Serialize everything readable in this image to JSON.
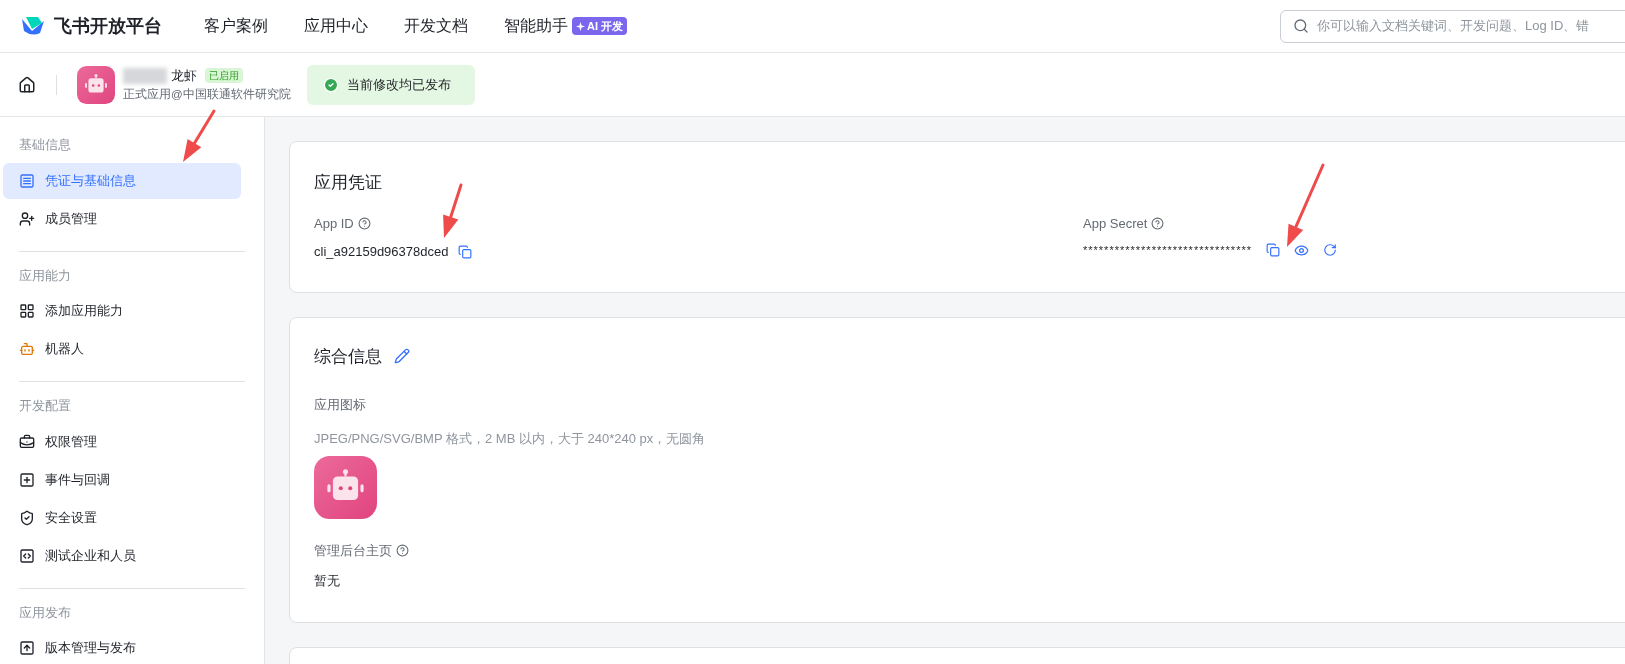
{
  "header": {
    "brand": "飞书开放平台",
    "nav": [
      {
        "label": "客户案例"
      },
      {
        "label": "应用中心"
      },
      {
        "label": "开发文档"
      },
      {
        "label": "智能助手",
        "badge": "AI 开发"
      }
    ],
    "search": {
      "placeholder": "你可以输入文档关键词、开发问题、Log ID、错"
    }
  },
  "app_bar": {
    "name": "龙虾",
    "status": "已启用",
    "org": "正式应用@中国联通软件研究院",
    "notice": "当前修改均已发布"
  },
  "sidebar": {
    "groups": [
      {
        "title": "基础信息",
        "items": [
          {
            "label": "凭证与基础信息",
            "kind": "card",
            "selected": true
          },
          {
            "label": "成员管理",
            "kind": "user",
            "selected": false
          }
        ]
      },
      {
        "title": "应用能力",
        "items": [
          {
            "label": "添加应用能力",
            "kind": "grid",
            "selected": false
          },
          {
            "label": "机器人",
            "kind": "bot",
            "selected": false
          }
        ]
      },
      {
        "title": "开发配置",
        "items": [
          {
            "label": "权限管理",
            "kind": "lock",
            "selected": false
          },
          {
            "label": "事件与回调",
            "kind": "event",
            "selected": false
          },
          {
            "label": "安全设置",
            "kind": "shield",
            "selected": false
          },
          {
            "label": "测试企业和人员",
            "kind": "code",
            "selected": false
          }
        ]
      },
      {
        "title": "应用发布",
        "items": [
          {
            "label": "版本管理与发布",
            "kind": "upload",
            "selected": false
          }
        ]
      }
    ]
  },
  "credentials": {
    "title": "应用凭证",
    "app_id": {
      "label": "App ID",
      "value": "cli_a92159d96378dced"
    },
    "app_secret": {
      "label": "App Secret",
      "value": "********************************"
    }
  },
  "general": {
    "title": "综合信息",
    "icon_label": "应用图标",
    "icon_hint": "JPEG/PNG/SVG/BMP 格式，2 MB 以内，大于 240*240 px，无圆角",
    "homepage_label": "管理后台主页",
    "homepage_value": "暂无"
  }
}
